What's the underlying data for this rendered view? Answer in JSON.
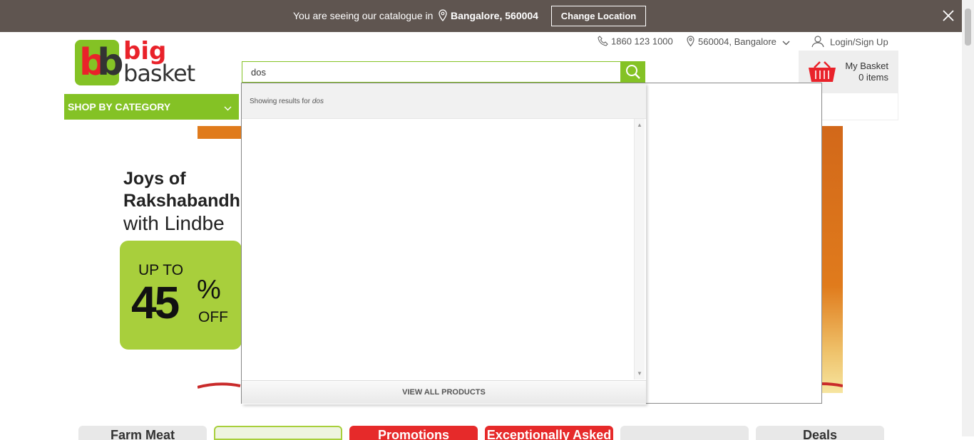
{
  "location_bar": {
    "message": "You are seeing our catalogue in",
    "city": "Bangalore, 560004",
    "change_label": "Change Location"
  },
  "logo": {
    "word1": "big",
    "word2": "basket"
  },
  "header": {
    "phone": "1860 123 1000",
    "pincode": "560004, Bangalore",
    "login": "Login/Sign Up"
  },
  "search": {
    "value": "dos"
  },
  "basket": {
    "title": "My Basket",
    "count": "0 items"
  },
  "category": {
    "label": "SHOP BY CATEGORY"
  },
  "banner": {
    "line1": "Joys of",
    "line2": "Rakshabandh",
    "line3": "with Lindbe",
    "offer_upto": "UP TO",
    "offer_pct": "45",
    "offer_sym": "%",
    "offer_off": "OFF"
  },
  "dropdown": {
    "showing_prefix": "Showing results for",
    "query": "dos",
    "view_all": "VIEW ALL PRODUCTS"
  },
  "tiles": [
    {
      "label": "Farm Meat",
      "bg": "#e8e8e8"
    },
    {
      "label": "",
      "bg": "#eef4e0"
    },
    {
      "label": "Promotions",
      "bg": "#e62a2a"
    },
    {
      "label": "Exceptionally Asked",
      "bg": "#e62a2a"
    },
    {
      "label": "",
      "bg": "#e8e8e8"
    },
    {
      "label": "Deals",
      "bg": "#e8e8e8"
    }
  ],
  "colors": {
    "brand_green": "#84c225",
    "brand_red": "#e9222a",
    "banner_bar": "#5f5550"
  }
}
